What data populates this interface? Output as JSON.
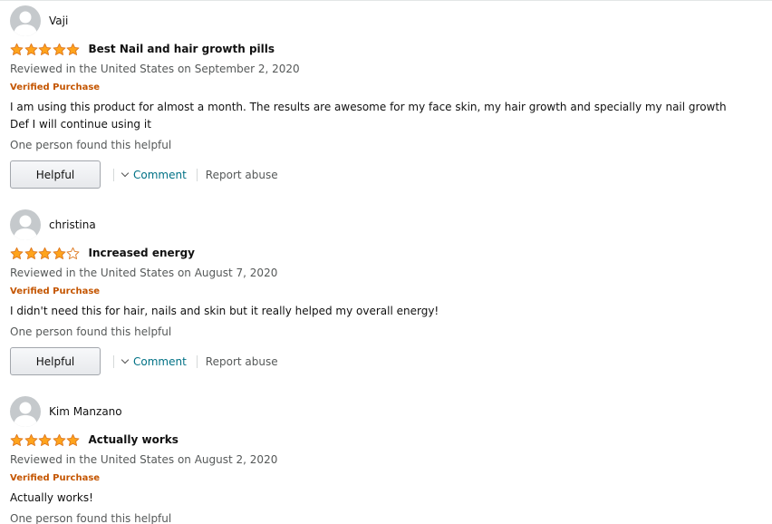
{
  "colors": {
    "star": "#ffa41c",
    "star_outline": "#de7921",
    "verified": "#c45500",
    "link": "#007185",
    "muted": "#565959"
  },
  "reviews": [
    {
      "profile_name": "Vaji",
      "rating": 5,
      "title": "Best Nail and hair growth pills",
      "date": "Reviewed in the United States on September 2, 2020",
      "verified": "Verified Purchase",
      "body": [
        "I am using this product for almost a month. The results are awesome for my face skin, my hair growth and specially my nail growth",
        "Def I will continue using it"
      ],
      "helpful_count": "One person found this helpful",
      "helpful_button": "Helpful",
      "comment": "Comment",
      "report": "Report abuse"
    },
    {
      "profile_name": "christina",
      "rating": 4,
      "title": "Increased energy",
      "date": "Reviewed in the United States on August 7, 2020",
      "verified": "Verified Purchase",
      "body": [
        "I didn't need this for hair, nails and skin but it really helped my overall energy!"
      ],
      "helpful_count": "One person found this helpful",
      "helpful_button": "Helpful",
      "comment": "Comment",
      "report": "Report abuse"
    },
    {
      "profile_name": "Kim Manzano",
      "rating": 5,
      "title": "Actually works",
      "date": "Reviewed in the United States on August 2, 2020",
      "verified": "Verified Purchase",
      "body": [
        "Actually works!"
      ],
      "helpful_count": "One person found this helpful"
    }
  ]
}
